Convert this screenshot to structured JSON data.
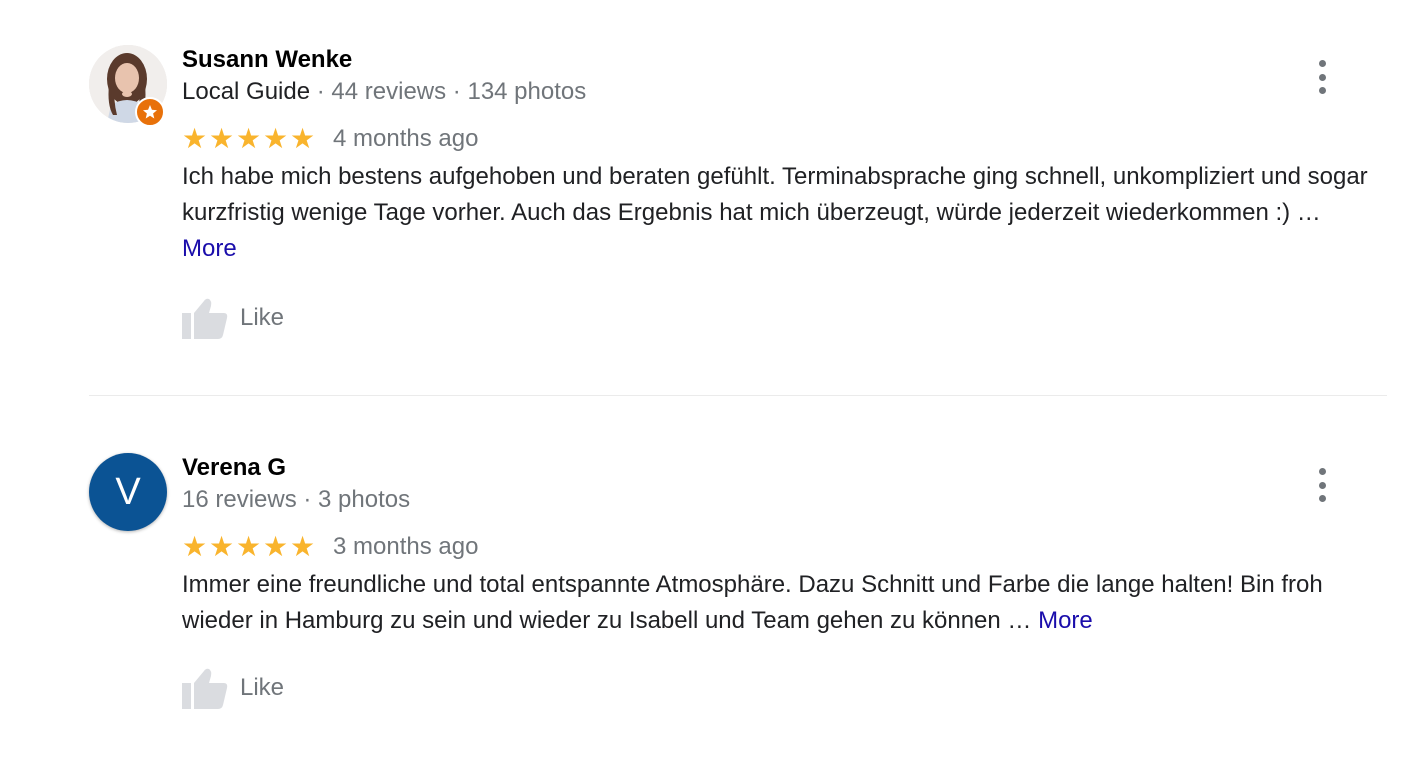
{
  "reviews": [
    {
      "author": "Susann Wenke",
      "guide_label": "Local Guide",
      "stats": " · 44 reviews · 134 photos",
      "rating": 5,
      "stars": "★★★★★",
      "time": "4 months ago",
      "text": "Ich habe mich bestens aufgehoben und beraten gefühlt. Terminabsprache ging schnell, unkompliziert und sogar kurzfristig wenige Tage vorher. Auch das Ergebnis hat mich überzeugt, würde jederzeit wiederkommen :) …",
      "more_label": "More",
      "like_label": "Like",
      "avatar_type": "photo",
      "badge_icon": "local-guide-star-icon"
    },
    {
      "author": "Verena G",
      "stats": "16 reviews · 3 photos",
      "rating": 5,
      "stars": "★★★★★",
      "time": "3 months ago",
      "text": "Immer eine freundliche und total entspannte Atmosphäre. Dazu Schnitt und Farbe die lange halten! Bin froh wieder in Hamburg zu sein und wieder zu Isabell und Team gehen zu können …",
      "more_label": "More",
      "like_label": "Like",
      "avatar_type": "letter",
      "avatar_letter": "V"
    }
  ],
  "colors": {
    "star": "#f9b42d",
    "link": "#1a0dab",
    "muted": "#70757a",
    "avatar_bg": "#0b5394",
    "guide_badge": "#e8710a"
  }
}
